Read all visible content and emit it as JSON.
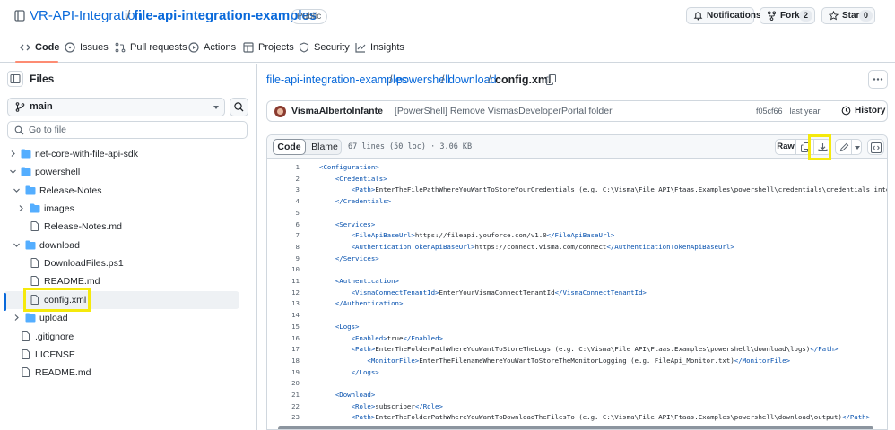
{
  "header": {
    "owner": "VR-API-Integration",
    "separator": "/",
    "repo": "file-api-integration-examples",
    "visibility": "Public",
    "notifications_label": "Notifications",
    "fork_label": "Fork",
    "fork_count": "2",
    "star_label": "Star",
    "star_count": "0"
  },
  "nav": {
    "tabs": [
      {
        "label": "Code",
        "icon": "code-icon",
        "active": true
      },
      {
        "label": "Issues",
        "icon": "issue-icon"
      },
      {
        "label": "Pull requests",
        "icon": "pull-request-icon"
      },
      {
        "label": "Actions",
        "icon": "play-icon"
      },
      {
        "label": "Projects",
        "icon": "table-icon"
      },
      {
        "label": "Security",
        "icon": "shield-icon"
      },
      {
        "label": "Insights",
        "icon": "graph-icon"
      }
    ],
    "active_color": "#fd8c73"
  },
  "sidebar": {
    "title": "Files",
    "branch": "main",
    "search_placeholder": "Go to file",
    "tree": [
      {
        "name": "net-core-with-file-api-sdk",
        "type": "folder",
        "expanded": false
      },
      {
        "name": "powershell",
        "type": "folder",
        "expanded": true
      },
      {
        "name": "Release-Notes",
        "type": "folder",
        "expanded": true
      },
      {
        "name": "images",
        "type": "folder",
        "expanded": false
      },
      {
        "name": "Release-Notes.md",
        "type": "file"
      },
      {
        "name": "download",
        "type": "folder",
        "expanded": true
      },
      {
        "name": "DownloadFiles.ps1",
        "type": "file"
      },
      {
        "name": "README.md",
        "type": "file"
      },
      {
        "name": "config.xml",
        "type": "file",
        "selected": true
      },
      {
        "name": "upload",
        "type": "folder",
        "expanded": false
      },
      {
        "name": ".gitignore",
        "type": "file"
      },
      {
        "name": "LICENSE",
        "type": "file"
      },
      {
        "name": "README.md",
        "type": "file"
      }
    ],
    "folder_color": "#54aeff",
    "highlight_color": "#f5e90c"
  },
  "path": {
    "parts": [
      "file-api-integration-examples",
      "powershell",
      "download"
    ],
    "separator": "/",
    "current": "config.xml"
  },
  "commit": {
    "author": "VismaAlbertoInfante",
    "message": "[PowerShell] Remove VismasDeveloperPortal folder",
    "meta": "f05cf66 · last year",
    "history_label": "History"
  },
  "file": {
    "code_tab": "Code",
    "blame_tab": "Blame",
    "info": "67 lines (50 loc) · 3.06 KB",
    "raw_label": "Raw",
    "lines": [
      {
        "n": "1",
        "t": "<Configuration>"
      },
      {
        "n": "2",
        "t": "    <Credentials>"
      },
      {
        "n": "3",
        "t": "        <Path>EnterTheFilePathWhereYouWantToStoreYourCredentials (e.g. C:\\Visma\\File API\\Ftaas.Examples\\powershell\\credentials\\credentials_integration."
      },
      {
        "n": "4",
        "t": "    </Credentials>"
      },
      {
        "n": "5",
        "t": ""
      },
      {
        "n": "6",
        "t": "    <Services>"
      },
      {
        "n": "7",
        "t": "        <FileApiBaseUrl>https://fileapi.youforce.com/v1.0</FileApiBaseUrl>"
      },
      {
        "n": "8",
        "t": "        <AuthenticationTokenApiBaseUrl>https://connect.visma.com/connect</AuthenticationTokenApiBaseUrl>"
      },
      {
        "n": "9",
        "t": "    </Services>"
      },
      {
        "n": "10",
        "t": ""
      },
      {
        "n": "11",
        "t": "    <Authentication>"
      },
      {
        "n": "12",
        "t": "        <VismaConnectTenantId>EnterYourVismaConnectTenantId</VismaConnectTenantId>"
      },
      {
        "n": "13",
        "t": "    </Authentication>"
      },
      {
        "n": "14",
        "t": ""
      },
      {
        "n": "15",
        "t": "    <Logs>"
      },
      {
        "n": "16",
        "t": "        <Enabled>true</Enabled>"
      },
      {
        "n": "17",
        "t": "        <Path>EnterTheFolderPathWhereYouWantToStoreTheLogs (e.g. C:\\Visma\\File API\\Ftaas.Examples\\powershell\\download\\logs)</Path>"
      },
      {
        "n": "18",
        "t": "            <MonitorFile>EnterTheFilenameWhereYouWantToStoreTheMonitorLogging (e.g. FileApi_Monitor.txt)</MonitorFile>"
      },
      {
        "n": "19",
        "t": "        </Logs>"
      },
      {
        "n": "20",
        "t": ""
      },
      {
        "n": "21",
        "t": "    <Download>"
      },
      {
        "n": "22",
        "t": "        <Role>subscriber</Role>"
      },
      {
        "n": "23",
        "t": "        <Path>EnterTheFolderPathWhereYouWantToDownloadTheFilesTo (e.g. C:\\Visma\\File API\\Ftaas.Examples\\powershell\\download\\output)</Path>"
      }
    ],
    "tag_color": "#0550ae"
  }
}
